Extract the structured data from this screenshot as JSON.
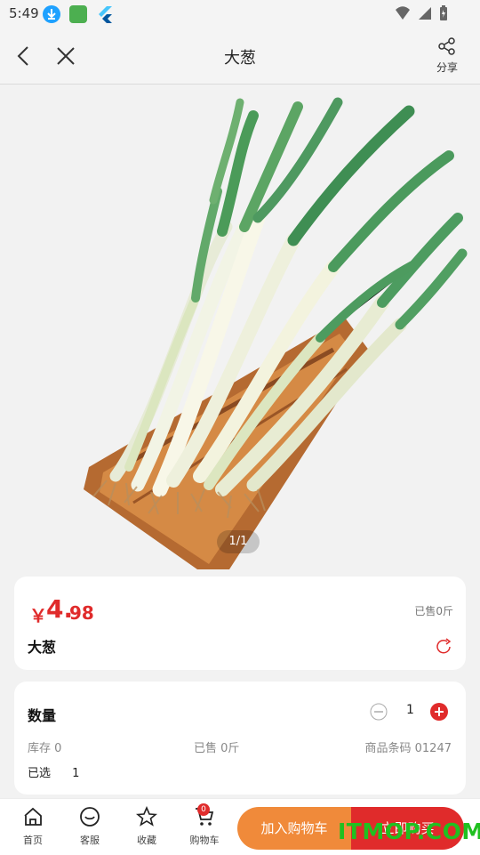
{
  "status_bar": {
    "time": "5:49",
    "icons": [
      "download-notification-icon",
      "app-notification-icon",
      "flutter-icon",
      "wifi-icon",
      "signal-icon",
      "battery-icon"
    ]
  },
  "header": {
    "title": "大葱",
    "share_label": "分享"
  },
  "gallery": {
    "indicator": "1/1"
  },
  "product": {
    "currency": "￥",
    "price_main": "4.",
    "price_decimal": "98",
    "sold_top": "已售0斤",
    "name": "大葱"
  },
  "quantity": {
    "label": "数量",
    "value": "1",
    "stock_label": "库存",
    "stock_value": "0",
    "sold_label": "已售",
    "sold_value": "0斤",
    "barcode_label": "商品条码",
    "barcode_value": "01247",
    "selected_label": "已选",
    "selected_value": "1"
  },
  "bottom_nav": {
    "home": "首页",
    "service": "客服",
    "favorite": "收藏",
    "cart": "购物车",
    "cart_count": "0",
    "add_to_cart": "加入购物车",
    "buy_now": "立即购买"
  },
  "watermark": "ITMOP.COM",
  "colors": {
    "accent": "#e02b2b",
    "orange": "#f08a3a",
    "background": "#f2f2f2",
    "watermark": "#20c020"
  }
}
